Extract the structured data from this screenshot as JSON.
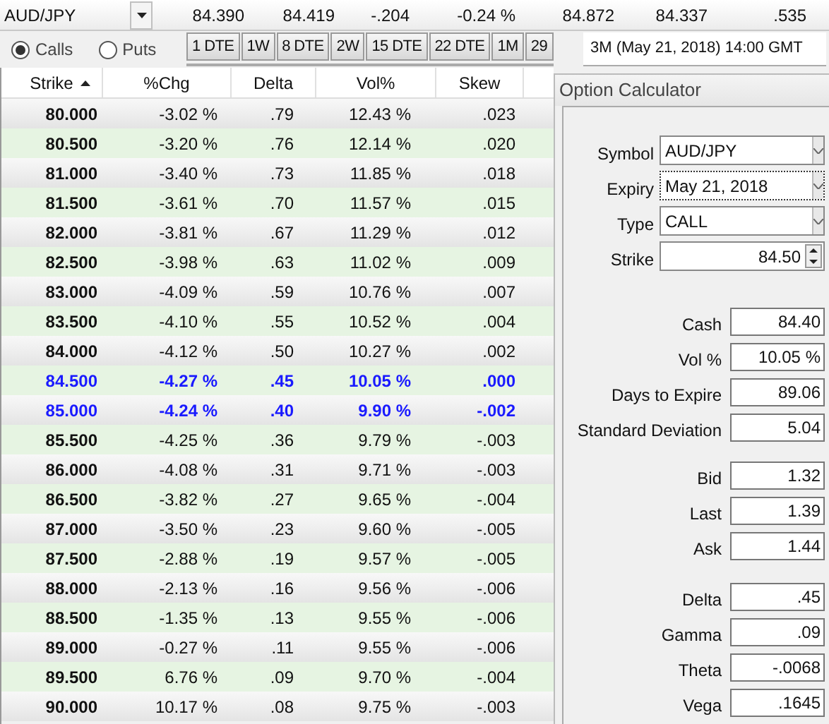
{
  "quote_bar": {
    "symbol": "AUD/JPY",
    "values": [
      "84.390",
      "84.419",
      "-.204",
      "-0.24 %",
      "84.872",
      "84.337",
      ".535"
    ]
  },
  "option_types": [
    {
      "label": "Calls",
      "selected": true
    },
    {
      "label": "Puts",
      "selected": false
    }
  ],
  "expiry_tabs": [
    {
      "label": "1 DTE"
    },
    {
      "label": "1W"
    },
    {
      "label": "8 DTE"
    },
    {
      "label": "2W"
    },
    {
      "label": "15 DTE"
    },
    {
      "label": "22 DTE"
    },
    {
      "label": "1M"
    },
    {
      "label": "29"
    }
  ],
  "tooltip": "3M (May 21, 2018) 14:00 GMT",
  "table": {
    "columns": [
      {
        "label": "Strike",
        "sorted": true
      },
      {
        "label": "%Chg",
        "sorted": false
      },
      {
        "label": "Delta",
        "sorted": false
      },
      {
        "label": "Vol%",
        "sorted": false
      },
      {
        "label": "Skew",
        "sorted": false
      }
    ],
    "rows": [
      {
        "cells": [
          "80.000",
          "-3.02 %",
          ".79",
          "12.43 %",
          ".023"
        ],
        "highlight": false
      },
      {
        "cells": [
          "80.500",
          "-3.20 %",
          ".76",
          "12.14 %",
          ".020"
        ],
        "highlight": false
      },
      {
        "cells": [
          "81.000",
          "-3.40 %",
          ".73",
          "11.85 %",
          ".018"
        ],
        "highlight": false
      },
      {
        "cells": [
          "81.500",
          "-3.61 %",
          ".70",
          "11.57 %",
          ".015"
        ],
        "highlight": false
      },
      {
        "cells": [
          "82.000",
          "-3.81 %",
          ".67",
          "11.29 %",
          ".012"
        ],
        "highlight": false
      },
      {
        "cells": [
          "82.500",
          "-3.98 %",
          ".63",
          "11.02 %",
          ".009"
        ],
        "highlight": false
      },
      {
        "cells": [
          "83.000",
          "-4.09 %",
          ".59",
          "10.76 %",
          ".007"
        ],
        "highlight": false
      },
      {
        "cells": [
          "83.500",
          "-4.10 %",
          ".55",
          "10.52 %",
          ".004"
        ],
        "highlight": false
      },
      {
        "cells": [
          "84.000",
          "-4.12 %",
          ".50",
          "10.27 %",
          ".002"
        ],
        "highlight": false
      },
      {
        "cells": [
          "84.500",
          "-4.27 %",
          ".45",
          "10.05 %",
          ".000"
        ],
        "highlight": true
      },
      {
        "cells": [
          "85.000",
          "-4.24 %",
          ".40",
          "9.90 %",
          "-.002"
        ],
        "highlight": true
      },
      {
        "cells": [
          "85.500",
          "-4.25 %",
          ".36",
          "9.79 %",
          "-.003"
        ],
        "highlight": false
      },
      {
        "cells": [
          "86.000",
          "-4.08 %",
          ".31",
          "9.71 %",
          "-.003"
        ],
        "highlight": false
      },
      {
        "cells": [
          "86.500",
          "-3.82 %",
          ".27",
          "9.65 %",
          "-.004"
        ],
        "highlight": false
      },
      {
        "cells": [
          "87.000",
          "-3.50 %",
          ".23",
          "9.60 %",
          "-.005"
        ],
        "highlight": false
      },
      {
        "cells": [
          "87.500",
          "-2.88 %",
          ".19",
          "9.57 %",
          "-.005"
        ],
        "highlight": false
      },
      {
        "cells": [
          "88.000",
          "-2.13 %",
          ".16",
          "9.56 %",
          "-.006"
        ],
        "highlight": false
      },
      {
        "cells": [
          "88.500",
          "-1.35 %",
          ".13",
          "9.55 %",
          "-.006"
        ],
        "highlight": false
      },
      {
        "cells": [
          "89.000",
          "-0.27 %",
          ".11",
          "9.55 %",
          "-.006"
        ],
        "highlight": false
      },
      {
        "cells": [
          "89.500",
          "6.76 %",
          ".09",
          "9.70 %",
          "-.004"
        ],
        "highlight": false
      },
      {
        "cells": [
          "90.000",
          "10.17 %",
          ".08",
          "9.75 %",
          "-.003"
        ],
        "highlight": false
      }
    ]
  },
  "calculator": {
    "title": "Option Calculator",
    "inputs": [
      {
        "label": "Symbol",
        "value": "AUD/JPY",
        "kind": "select",
        "focused": false
      },
      {
        "label": "Expiry",
        "value": "May 21, 2018",
        "kind": "select",
        "focused": true
      },
      {
        "label": "Type",
        "value": "CALL",
        "kind": "select",
        "focused": false
      },
      {
        "label": "Strike",
        "value": "84.50",
        "kind": "spin",
        "focused": false
      }
    ],
    "groups": [
      [
        {
          "label": "Cash",
          "value": "84.40"
        },
        {
          "label": "Vol %",
          "value": "10.05 %"
        },
        {
          "label": "Days to Expire",
          "value": "89.06"
        },
        {
          "label": "Standard Deviation",
          "value": "5.04"
        }
      ],
      [
        {
          "label": "Bid",
          "value": "1.32"
        },
        {
          "label": "Last",
          "value": "1.39"
        },
        {
          "label": "Ask",
          "value": "1.44"
        }
      ],
      [
        {
          "label": "Delta",
          "value": ".45"
        },
        {
          "label": "Gamma",
          "value": ".09"
        },
        {
          "label": "Theta",
          "value": "-.0068"
        },
        {
          "label": "Vega",
          "value": ".1645"
        }
      ]
    ]
  }
}
